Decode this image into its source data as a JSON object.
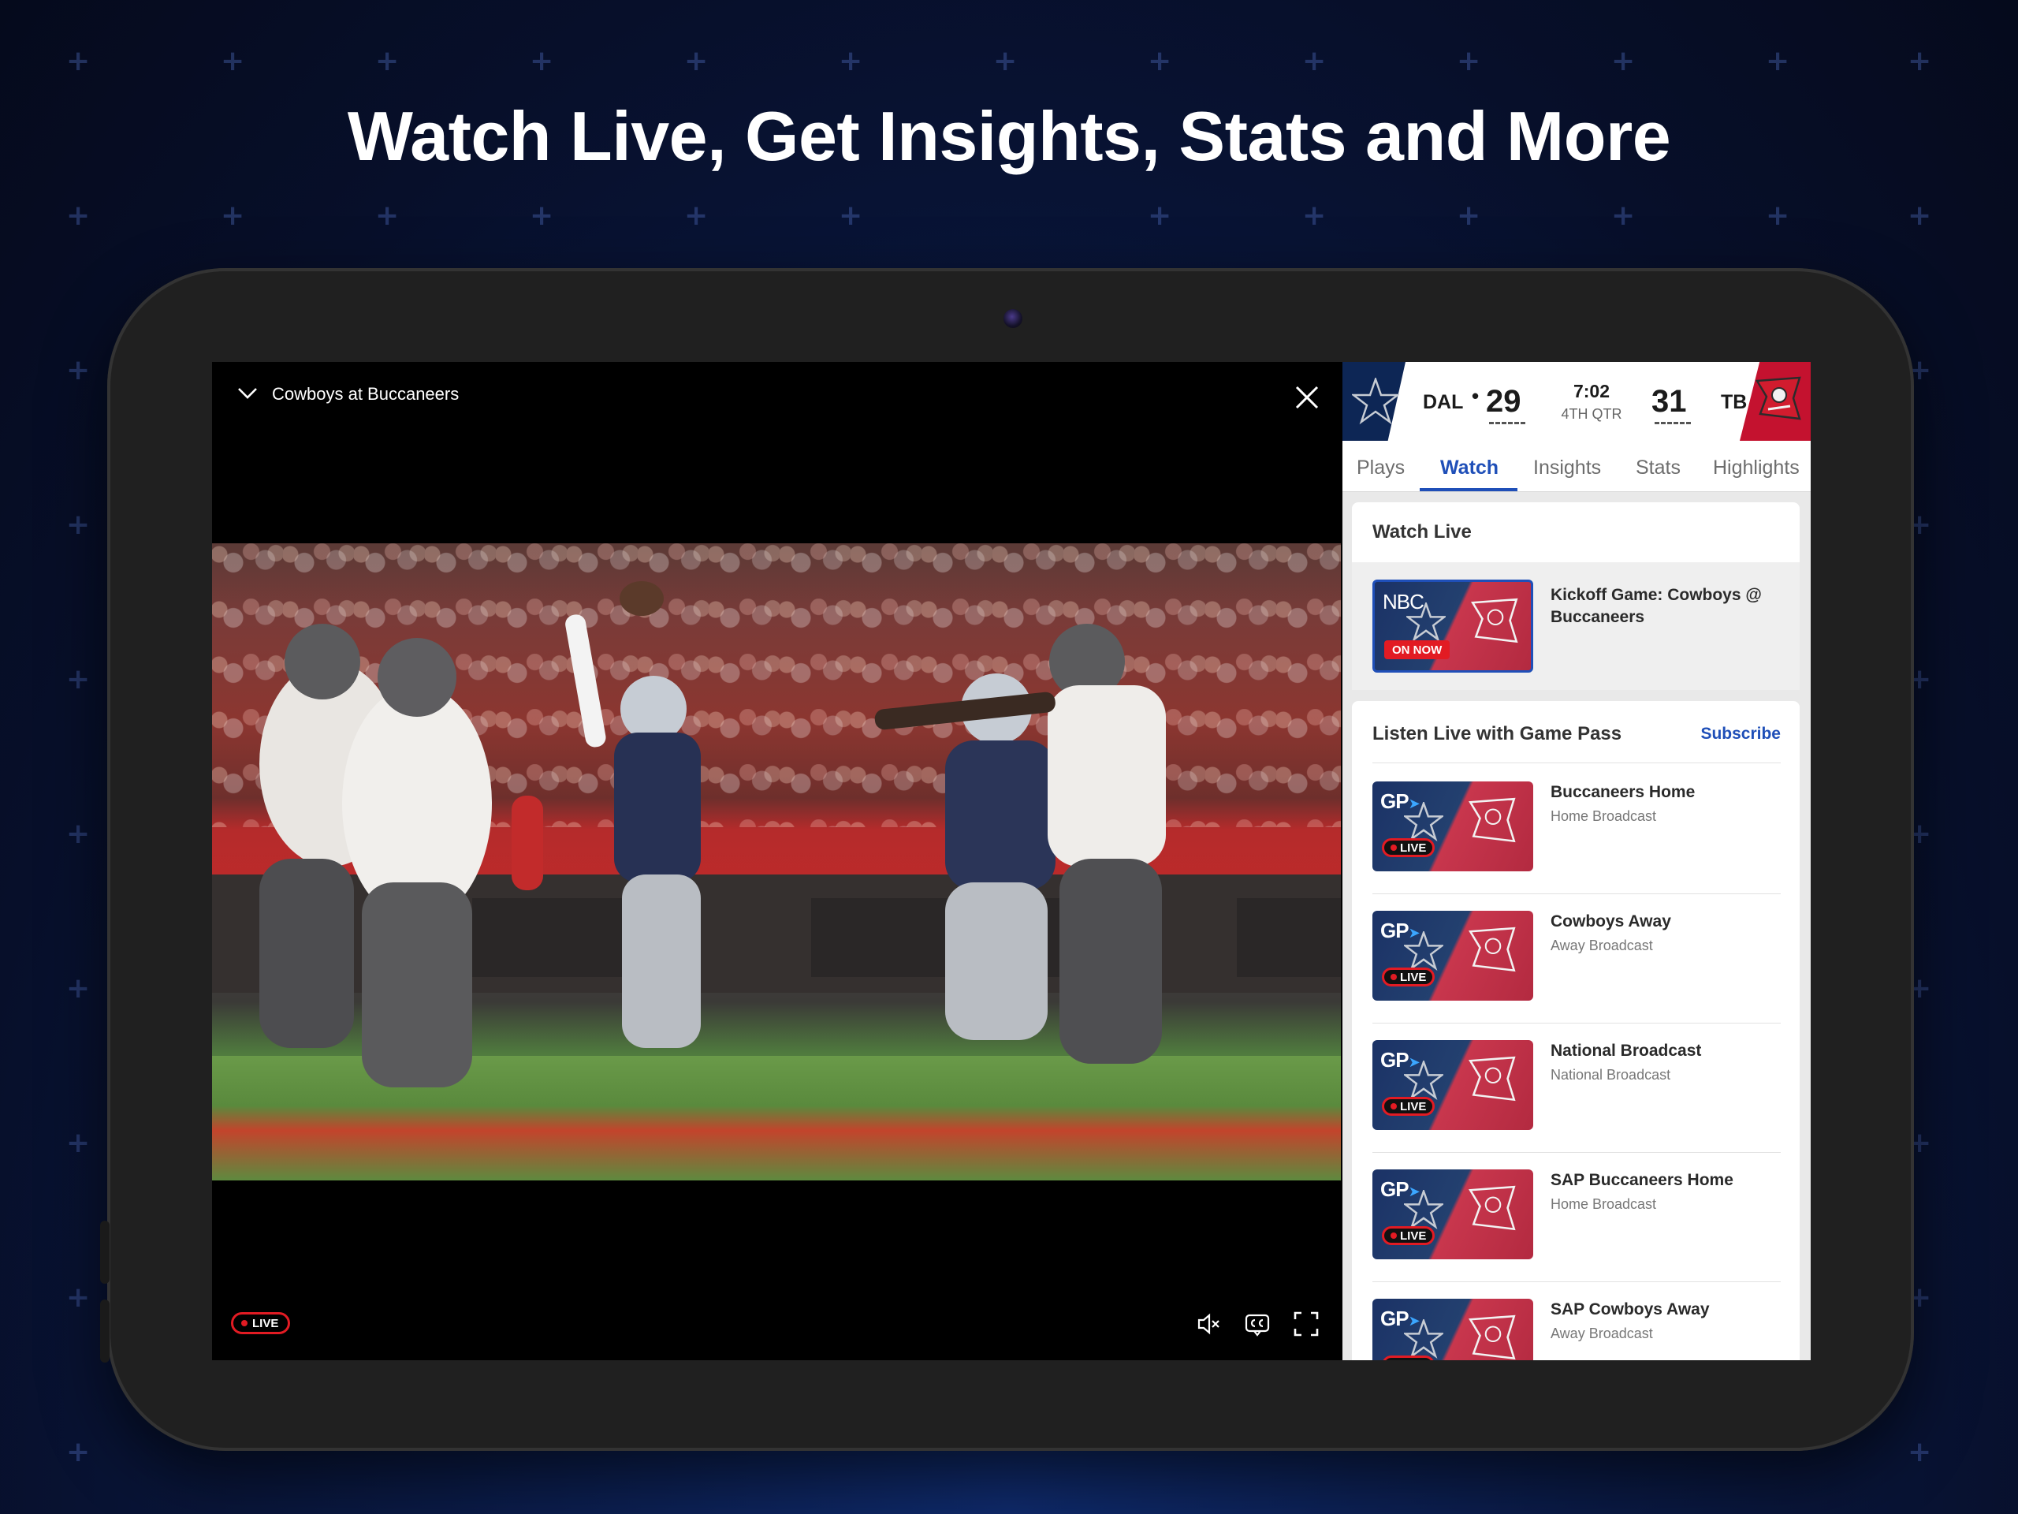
{
  "headline": "Watch Live, Get Insights, Stats and More",
  "video": {
    "title": "Cowboys at Buccaneers",
    "live_label": "LIVE"
  },
  "scoreboard": {
    "away_team": "DAL",
    "away_score": "29",
    "clock": "7:02",
    "quarter": "4TH QTR",
    "home_score": "31",
    "home_team": "TB",
    "colors": {
      "away": "#0d2655",
      "home": "#c4122f"
    }
  },
  "tabs": [
    {
      "label": "Plays"
    },
    {
      "label": "Watch"
    },
    {
      "label": "Insights"
    },
    {
      "label": "Stats"
    },
    {
      "label": "Highlights"
    }
  ],
  "active_tab": "Watch",
  "watch_live": {
    "title": "Watch Live",
    "item": {
      "network": "NBC",
      "badge": "ON NOW",
      "title": "Kickoff Game: Cowboys @ Buccaneers"
    }
  },
  "listen_live": {
    "title": "Listen Live with Game Pass",
    "subscribe_label": "Subscribe",
    "badge": "LIVE",
    "logo": "GP",
    "items": [
      {
        "title": "Buccaneers Home",
        "subtitle": "Home Broadcast"
      },
      {
        "title": "Cowboys Away",
        "subtitle": "Away Broadcast"
      },
      {
        "title": "National Broadcast",
        "subtitle": "National Broadcast"
      },
      {
        "title": "SAP Buccaneers Home",
        "subtitle": "Home Broadcast"
      },
      {
        "title": "SAP Cowboys Away",
        "subtitle": "Away Broadcast"
      }
    ]
  },
  "icons": [
    "chevron-down-icon",
    "close-icon",
    "mute-icon",
    "closed-captions-icon",
    "fullscreen-icon",
    "cowboys-star-icon",
    "buccaneers-flag-icon"
  ],
  "colors": {
    "accent": "#1f4fb8",
    "live": "#e21b23",
    "background": "#0a1a45"
  }
}
